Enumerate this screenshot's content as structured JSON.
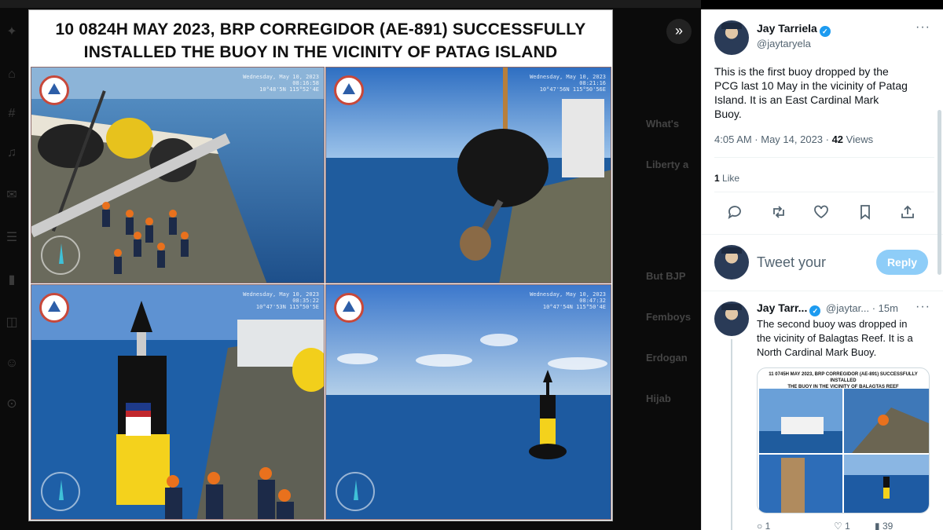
{
  "viewer": {
    "title_line1": "10 0824H MAY 2023, BRP CORREGIDOR (AE-891)  SUCCESSFULLY",
    "title_line2": "INSTALLED THE BUOY IN THE VICINITY OF PATAG ISLAND",
    "photos": [
      {
        "name": "deck-crew-buoys",
        "stamp_line1": "Wednesday, May 10, 2023 08:16:58",
        "stamp_line2": "10°48'5N 115°52'4E"
      },
      {
        "name": "buoy-on-crane",
        "stamp_line1": "Wednesday, May 10, 2023 08:21:16",
        "stamp_line2": "10°47'56N 115°50'56E"
      },
      {
        "name": "buoy-lowered",
        "stamp_line1": "Wednesday, May 10, 2023 08:35:22",
        "stamp_line2": "10°47'53N 115°50'5E"
      },
      {
        "name": "buoy-floating",
        "stamp_line1": "Wednesday, May 10, 2023 08:47:32",
        "stamp_line2": "10°47'54N 115°50'4E"
      }
    ],
    "expand_icon": "»"
  },
  "underlay": {
    "items": [
      "What's",
      "Liberty a",
      "But BJP",
      "Femboys",
      "Erdogan",
      "Hijab"
    ]
  },
  "tweet": {
    "author_name": "Jay Tarriela",
    "author_handle": "@jaytaryela",
    "text_lines": [
      "This is the first buoy dropped by the",
      "PCG last 10 May in the vicinity of Patag",
      "Island. It is an East Cardinal Mark",
      "Buoy."
    ],
    "timestamp": "4:05 AM · May 14, 2023 · ",
    "views_count": "42",
    "views_label": " Views",
    "likes_count": "1",
    "likes_label": " Like",
    "more_icon": "···"
  },
  "actions": {
    "reply_icon": "comment-icon",
    "retweet_icon": "retweet-icon",
    "like_icon": "heart-icon",
    "bookmark_icon": "bookmark-icon",
    "share_icon": "share-icon"
  },
  "composer": {
    "placeholder": "Tweet your",
    "button_label": "Reply"
  },
  "reply_tweet": {
    "author_name": "Jay Tarr...",
    "author_handle": "@jaytar...",
    "time": "· 15m",
    "text_lines": [
      "The second buoy was dropped in",
      "the vicinity of Balagtas Reef. It is a",
      "North Cardinal Mark Buoy."
    ],
    "card_title_line1": "11 0745H MAY 2023, BRP CORREGIDOR (AE-891)  SUCCESSFULLY INSTALLED",
    "card_title_line2": "THE BUOY IN THE VICINITY OF BALAGTAS REEF",
    "stats": [
      "1",
      "1",
      "39"
    ]
  },
  "colors": {
    "accent": "#1d9bf0",
    "reply_button": "#8ecdf8",
    "buoy_yellow": "#f4d21c",
    "sea_blue": "#1f5c9e"
  }
}
